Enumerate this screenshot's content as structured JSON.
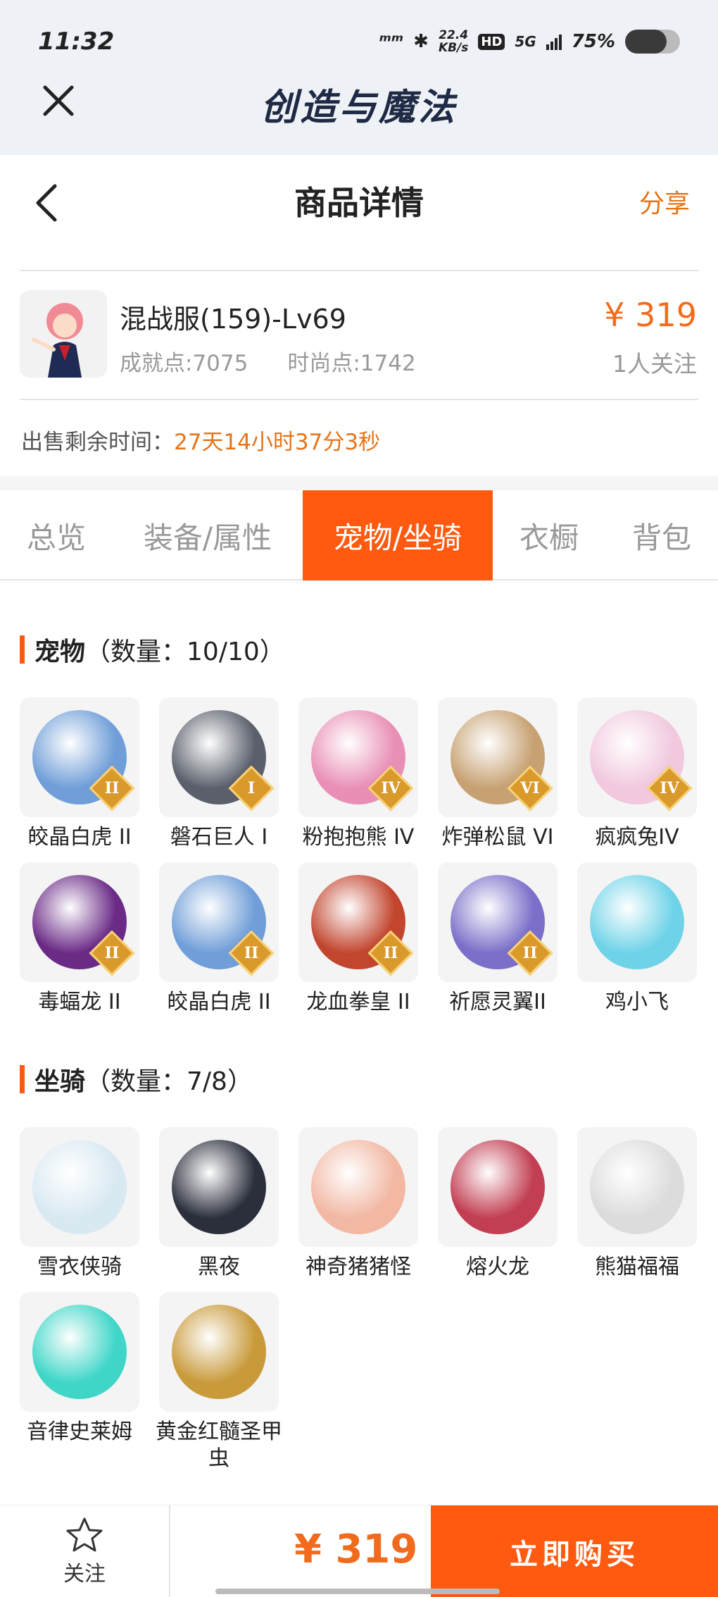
{
  "status_bar": {
    "time": "11:32",
    "net_speed": "22.4",
    "net_unit": "KB/s",
    "hd": "HD",
    "network": "5G",
    "battery": "75%",
    "battery_level": 0.75
  },
  "app": {
    "title": "创造与魔法"
  },
  "nav": {
    "title": "商品详情",
    "share": "分享"
  },
  "product": {
    "name": "混战服(159)-Lv69",
    "achievement": "成就点:7075",
    "fashion": "时尚点:1742",
    "price": "¥ 319",
    "followers": "1人关注"
  },
  "sale": {
    "label": "出售剩余时间：",
    "remaining": "27天14小时37分3秒"
  },
  "tabs": [
    {
      "label": "总览"
    },
    {
      "label": "装备/属性"
    },
    {
      "label": "宠物/坐骑"
    },
    {
      "label": "衣橱"
    },
    {
      "label": "背包"
    }
  ],
  "active_tab": "宠物/坐骑",
  "pets": {
    "title": "宠物",
    "count": "（数量：10/10）",
    "items": [
      {
        "name": "皎晶白虎 II",
        "badge": "II",
        "color": "#6f9ed8"
      },
      {
        "name": "磐石巨人 I",
        "badge": "I",
        "color": "#5a5f6b"
      },
      {
        "name": "粉抱抱熊 IV",
        "badge": "IV",
        "color": "#e98fb6"
      },
      {
        "name": "炸弹松鼠 VI",
        "badge": "VI",
        "color": "#c7a172"
      },
      {
        "name": "疯疯兔IV",
        "badge": "IV",
        "color": "#f1c8de"
      },
      {
        "name": "毒蝠龙 II",
        "badge": "II",
        "color": "#6a2a86"
      },
      {
        "name": "皎晶白虎 II",
        "badge": "II",
        "color": "#6f9ed8"
      },
      {
        "name": "龙血拳皇 II",
        "badge": "II",
        "color": "#c2452e"
      },
      {
        "name": "祈愿灵翼II",
        "badge": "II",
        "color": "#7a6fc9"
      },
      {
        "name": "鸡小飞",
        "badge": "",
        "color": "#6fd3e8"
      }
    ]
  },
  "mounts": {
    "title": "坐骑",
    "count": "（数量：7/8）",
    "items": [
      {
        "name": "雪衣侠骑",
        "color": "#d9e9f2"
      },
      {
        "name": "黑夜",
        "color": "#2b2f3c"
      },
      {
        "name": "神奇猪猪怪",
        "color": "#f2b8a4"
      },
      {
        "name": "熔火龙",
        "color": "#c23e52"
      },
      {
        "name": "熊猫福福",
        "color": "#dcdcdc"
      },
      {
        "name": "音律史莱姆",
        "color": "#3fd6c8"
      },
      {
        "name": "黄金红髓圣甲虫",
        "color": "#c99a3a"
      }
    ]
  },
  "bottom": {
    "follow": "关注",
    "price": "¥ 319",
    "buy": "立即购买"
  }
}
